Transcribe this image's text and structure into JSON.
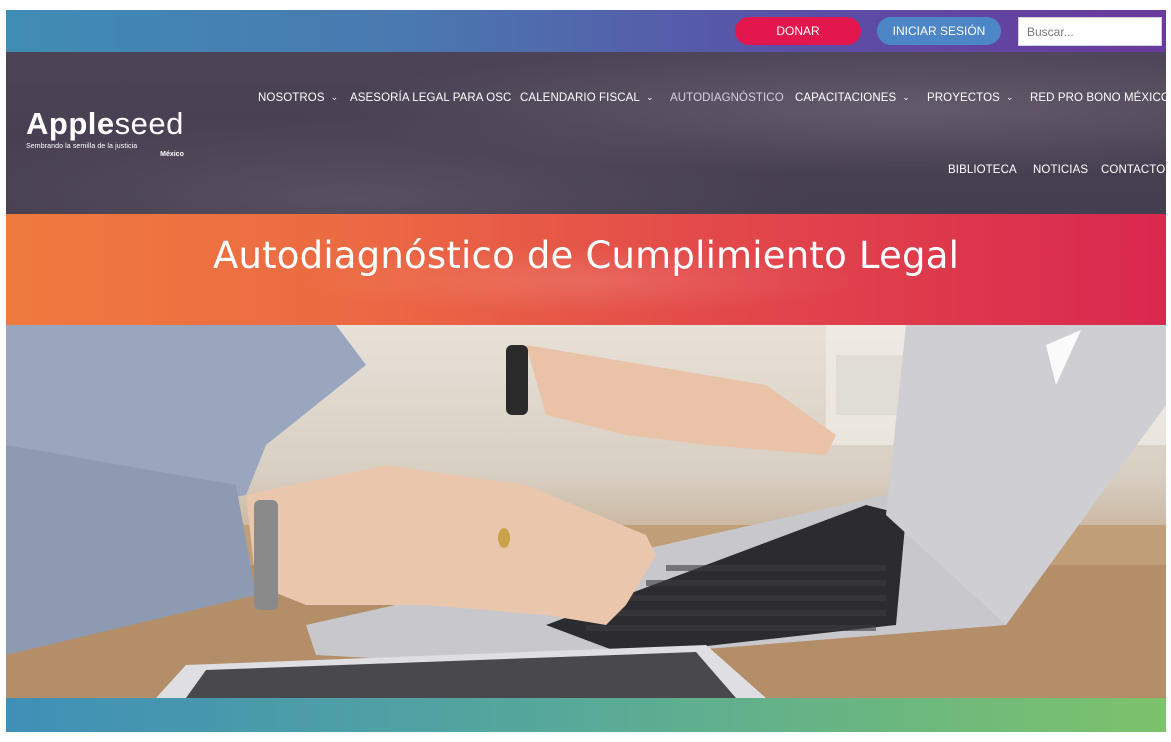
{
  "topbar": {
    "donate_label": "DONAR",
    "login_label": "INICIAR SESIÓN",
    "search_placeholder": "Buscar..."
  },
  "logo": {
    "word_bold": "Apple",
    "word_light": "seed",
    "tagline": "Sembrando la semilla de la justicia",
    "country": "México"
  },
  "nav": {
    "items": [
      {
        "label": "NOSOTROS",
        "dropdown": true
      },
      {
        "label": "ASESORÍA LEGAL PARA OSC",
        "dropdown": false
      },
      {
        "label": "CALENDARIO FISCAL",
        "dropdown": true
      },
      {
        "label": "AUTODIAGNÓSTICO",
        "dropdown": false,
        "active": true
      },
      {
        "label": "CAPACITACIONES",
        "dropdown": true
      },
      {
        "label": "PROYECTOS",
        "dropdown": true
      },
      {
        "label": "RED PRO BONO MÉXICO",
        "dropdown": false
      },
      {
        "label": "BIBLIOTECA",
        "dropdown": false
      },
      {
        "label": "NOTICIAS",
        "dropdown": false
      },
      {
        "label": "CONTACTO",
        "dropdown": false
      }
    ],
    "chevron_icon": "chevron-down-icon"
  },
  "page": {
    "title": "Autodiagnóstico de Cumplimiento Legal"
  },
  "colors": {
    "donate": "#e3174d",
    "login": "#4d86c7",
    "header_bg": "#4a4253",
    "title_band_start": "#ef7a3e",
    "title_band_end": "#d9284f"
  }
}
